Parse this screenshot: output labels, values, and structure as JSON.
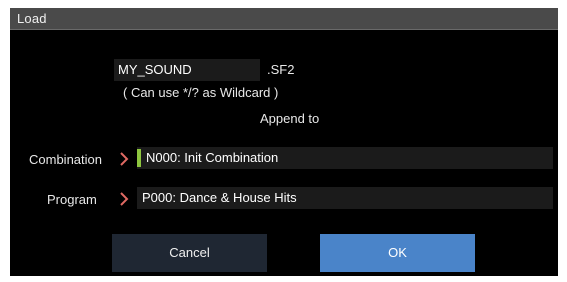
{
  "dialog": {
    "title": "Load"
  },
  "file": {
    "name": "MY_SOUND",
    "extension": ".SF2",
    "wildcard_hint": "( Can use */? as Wildcard )",
    "append_label": "Append to"
  },
  "rows": [
    {
      "label": "Combination",
      "value": "N000: Init Combination",
      "selected": true
    },
    {
      "label": "Program",
      "value": "P000: Dance & House Hits",
      "selected": false
    }
  ],
  "buttons": {
    "cancel": "Cancel",
    "ok": "OK"
  },
  "icons": {
    "row_arrow": "chevron-right-icon"
  },
  "colors": {
    "dialog_bg": "#000000",
    "titlebar_bg": "#4a4a4a",
    "field_bg": "#1b1b1b",
    "chevron": "#e06a63",
    "selection_cursor": "#8ec63f",
    "cancel_button": "#1f2733",
    "ok_button": "#4a84c9"
  }
}
